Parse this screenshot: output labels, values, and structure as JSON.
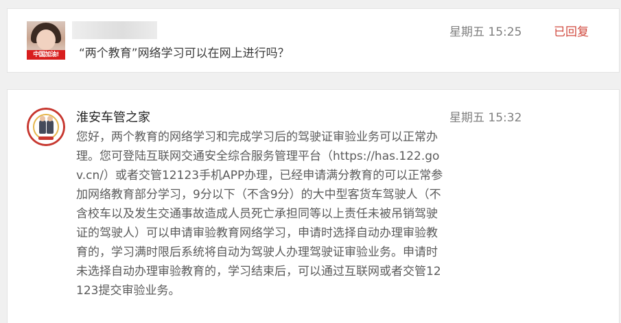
{
  "messages": [
    {
      "time": "星期五 15:25",
      "status": "已回复",
      "text": "“两个教育”网络学习可以在网上进行吗？",
      "avatar_banner": "中国加油!"
    },
    {
      "sender": "淮安车管之家",
      "time": "星期五 15:32",
      "lines": [
        "您好，两个教育的网络学习和完成学习后的驾驶证审验业务可以正常办",
        "理。您可登陆互联网交通安全综合服务管理平台（https://has.122.go",
        "v.cn/）或者交管12123手机APP办理，已经申请满分教育的可以正常参",
        "加网络教育部分学习，9分以下（不含9分）的大中型客货车驾驶人（不",
        "含校车以及发生交通事故造成人员死亡承担同等以上责任未被吊销驾驶",
        "证的驾驶人）可以申请审验教育网络学习，申请时选择自动办理审验教",
        "育的，学习满时限后系统将自动为驾驶人办理驾驶证审验业务。申请时",
        "未选择自动办理审验教育的，学习结束后，可以通过互联网或者交管12",
        "123提交审验业务。"
      ]
    }
  ],
  "colors": {
    "status": "#d0493e",
    "time": "#7f7f7f",
    "background": "#f0f0f0",
    "emblem_ring": "#c7372f"
  },
  "icons": {
    "user_avatar": "user-photo-avatar",
    "official_avatar": "police-emblem-avatar"
  }
}
